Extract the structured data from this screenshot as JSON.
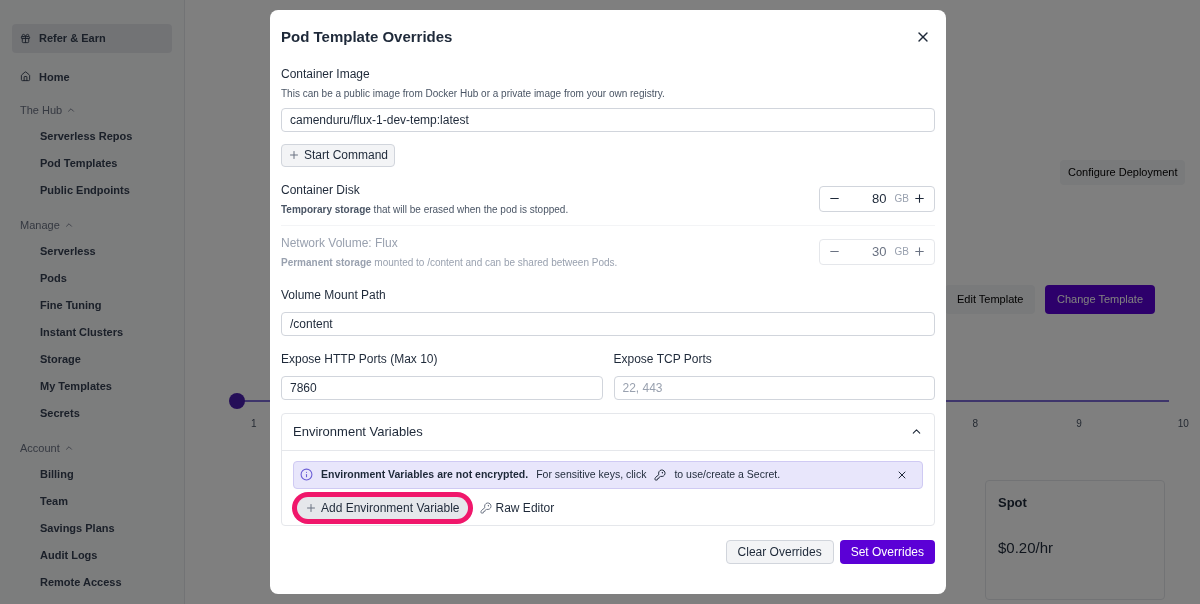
{
  "sidebar": {
    "refer": "Refer & Earn",
    "home": "Home",
    "sections": [
      {
        "title": "The Hub",
        "expanded": true,
        "items": [
          "Serverless Repos",
          "Pod Templates",
          "Public Endpoints"
        ]
      },
      {
        "title": "Manage",
        "expanded": true,
        "items": [
          "Serverless",
          "Pods",
          "Fine Tuning",
          "Instant Clusters",
          "Storage",
          "My Templates",
          "Secrets"
        ]
      },
      {
        "title": "Account",
        "expanded": true,
        "items": [
          "Billing",
          "Team",
          "Savings Plans",
          "Audit Logs",
          "Remote Access"
        ]
      }
    ]
  },
  "background": {
    "configure_button": "Configure Deployment",
    "edit_template": "Edit Template",
    "change_template": "Change Template",
    "slider": {
      "level": 0,
      "ticks": [
        "1",
        "8",
        "9",
        "10"
      ]
    },
    "spot": {
      "title": "Spot",
      "price": "$0.20/hr"
    }
  },
  "modal": {
    "title": "Pod Template Overrides",
    "container_image": {
      "label": "Container Image",
      "hint": "This can be a public image from Docker Hub or a private image from your own registry.",
      "value": "camenduru/flux-1-dev-temp:latest"
    },
    "start_command": "Start Command",
    "disks": [
      {
        "label": "Container Disk",
        "hint": "**Temporary storage** that will be erased when the pod is stopped.",
        "value": "80",
        "unit": "GB",
        "disabled": false
      },
      {
        "label": "Network Volume: Flux",
        "hint": "**Permanent storage** mounted to /content and can be shared between Pods.",
        "value": "30",
        "unit": "GB",
        "disabled": true
      }
    ],
    "mount_path": {
      "label": "Volume Mount Path",
      "value": "/content"
    },
    "http_ports": {
      "label": "Expose HTTP Ports (Max 10)",
      "value": "7860"
    },
    "tcp_ports": {
      "label": "Expose TCP Ports",
      "placeholder": "22, 443"
    },
    "env": {
      "title": "Environment Variables",
      "expanded": true,
      "notice_bold": "Environment Variables are not encrypted.",
      "notice_before": "For sensitive keys, click",
      "notice_after": "to use/create a Secret.",
      "add_button": "Add Environment Variable",
      "add_highlighted": true,
      "raw_editor": "Raw Editor"
    },
    "buttons": [
      "Clear Overrides",
      "Set Overrides"
    ]
  }
}
